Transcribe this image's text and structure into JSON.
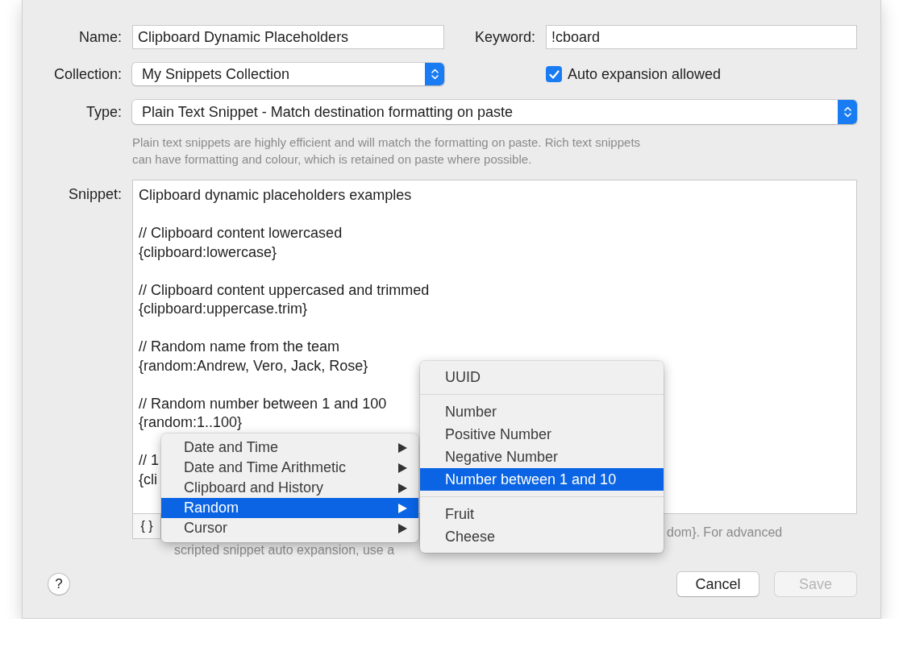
{
  "form": {
    "name": {
      "label": "Name:",
      "value": "Clipboard Dynamic Placeholders"
    },
    "keyword": {
      "label": "Keyword:",
      "value": "!cboard"
    },
    "collection": {
      "label": "Collection:",
      "value": "My Snippets Collection"
    },
    "auto_expansion": {
      "label": "Auto expansion allowed",
      "checked": true
    },
    "type": {
      "label": "Type:",
      "value": "Plain Text Snippet - Match destination formatting on paste"
    },
    "type_hint": [
      "Plain text snippets are highly efficient and will match the formatting on paste. Rich text snippets",
      "can have formatting and colour, which is retained on paste where possible."
    ]
  },
  "snippet": {
    "label": "Snippet:",
    "paragraphs": [
      [
        "Clipboard dynamic placeholders examples"
      ],
      [
        "// Clipboard content lowercased",
        "{clipboard:lowercase}"
      ],
      [
        "// Clipboard content uppercased and trimmed",
        "{clipboard:uppercase.trim}"
      ],
      [
        "// Random name from the team",
        "{random:Andrew, Vero, Jack, Rose}"
      ],
      [
        "// Random number between 1 and 100",
        "{random:1..100}"
      ],
      [
        "// 1",
        "{cli"
      ]
    ],
    "placeholder_button": "{ }",
    "hint": [
      "dom}. For advanced",
      "scripted snippet auto expansion, use a"
    ]
  },
  "placeholder_menu": [
    {
      "label": "Date and Time",
      "submenu": true,
      "selected": false
    },
    {
      "label": "Date and Time Arithmetic",
      "submenu": true,
      "selected": false
    },
    {
      "label": "Clipboard and History",
      "submenu": true,
      "selected": false
    },
    {
      "label": "Random",
      "submenu": true,
      "selected": true
    },
    {
      "label": "Cursor",
      "submenu": true,
      "selected": false
    }
  ],
  "random_submenu": [
    [
      {
        "label": "UUID",
        "selected": false
      }
    ],
    [
      {
        "label": "Number",
        "selected": false
      },
      {
        "label": "Positive Number",
        "selected": false
      },
      {
        "label": "Negative Number",
        "selected": false
      },
      {
        "label": "Number between 1 and 10",
        "selected": true
      }
    ],
    [
      {
        "label": "Fruit",
        "selected": false
      },
      {
        "label": "Cheese",
        "selected": false
      }
    ]
  ],
  "buttons": {
    "help": "?",
    "cancel": {
      "label": "Cancel",
      "disabled": false
    },
    "save": {
      "label": "Save",
      "disabled": true
    }
  }
}
